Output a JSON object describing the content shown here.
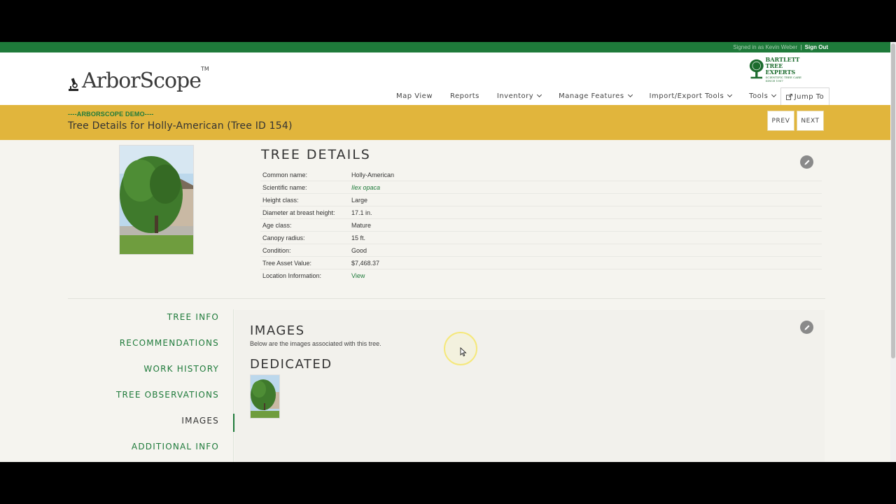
{
  "session": {
    "signed_in_text": "Signed in as Kevin Weber",
    "separator": "|",
    "sign_out": "Sign Out"
  },
  "brand": {
    "logo_text": "ArborScope",
    "trademark": "TM",
    "partner_line1": "BARTLETT",
    "partner_line2": "TREE EXPERTS",
    "partner_tagline": "SCIENTIFIC TREE CARE SINCE 1907"
  },
  "nav": {
    "items": [
      {
        "label": "Map View"
      },
      {
        "label": "Reports"
      },
      {
        "label": "Inventory"
      },
      {
        "label": "Manage Features"
      },
      {
        "label": "Import/Export Tools"
      },
      {
        "label": "Tools"
      }
    ],
    "jump_to": "Jump To"
  },
  "banner": {
    "demo_label": "----ARBORSCOPE DEMO----",
    "title": "Tree Details for Holly-American (Tree ID 154)",
    "prev": "PREV",
    "next": "NEXT"
  },
  "details": {
    "heading": "TREE DETAILS",
    "rows": [
      {
        "label": "Common name:",
        "value": "Holly-American"
      },
      {
        "label": "Scientific name:",
        "value": "Ilex opaca"
      },
      {
        "label": "Height class:",
        "value": "Large"
      },
      {
        "label": "Diameter at breast height:",
        "value": "17.1 in."
      },
      {
        "label": "Age class:",
        "value": "Mature"
      },
      {
        "label": "Canopy radius:",
        "value": "15 ft."
      },
      {
        "label": "Condition:",
        "value": "Good"
      },
      {
        "label": "Tree Asset Value:",
        "value": "$7,468.37"
      },
      {
        "label": "Location Information:",
        "value": "View"
      }
    ]
  },
  "sidenav": {
    "items": [
      {
        "label": "TREE INFO"
      },
      {
        "label": "RECOMMENDATIONS"
      },
      {
        "label": "WORK HISTORY"
      },
      {
        "label": "TREE OBSERVATIONS"
      },
      {
        "label": "IMAGES"
      },
      {
        "label": "ADDITIONAL INFO"
      }
    ],
    "active_index": 4
  },
  "images": {
    "heading": "IMAGES",
    "description": "Below are the images associated with this tree.",
    "dedicated_heading": "DEDICATED"
  },
  "colors": {
    "brand_green": "#1e7a3a",
    "banner_gold": "#e1b53c",
    "page_bg": "#f5f4ef"
  }
}
